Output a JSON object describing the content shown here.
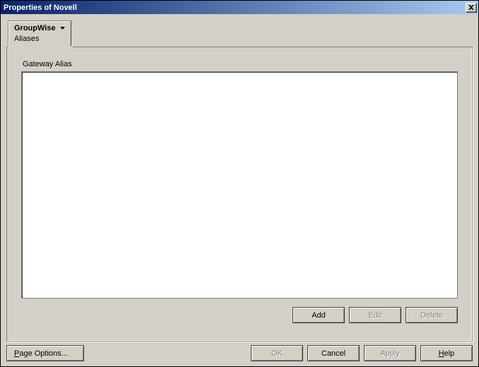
{
  "window": {
    "title": "Properties of Novell",
    "close_icon": "×"
  },
  "tab": {
    "label": "GroupWise",
    "sublabel": "Aliases"
  },
  "panel": {
    "label": "Gateway Alias",
    "buttons": {
      "add": "Add",
      "edit": "Edit",
      "delete": "Delete"
    }
  },
  "footer": {
    "page_options": "Page Options...",
    "page_options_ul": "P",
    "ok": "OK",
    "cancel": "Cancel",
    "apply": "Apply",
    "help": "Help",
    "help_ul": "H"
  }
}
